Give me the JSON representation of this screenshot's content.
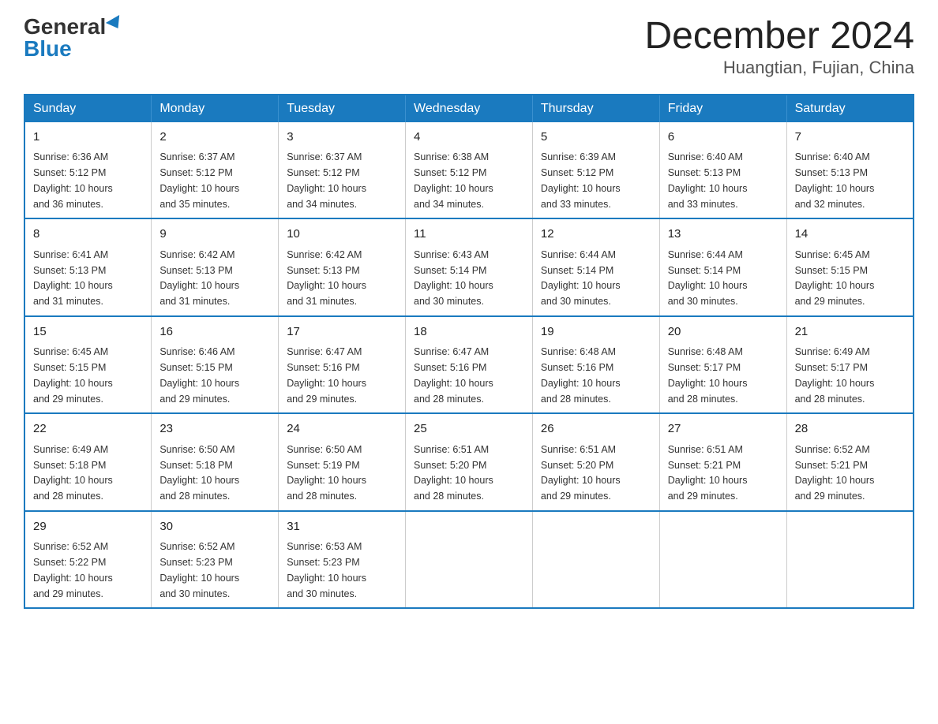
{
  "logo": {
    "general": "General",
    "blue": "Blue"
  },
  "title": "December 2024",
  "subtitle": "Huangtian, Fujian, China",
  "days_of_week": [
    "Sunday",
    "Monday",
    "Tuesday",
    "Wednesday",
    "Thursday",
    "Friday",
    "Saturday"
  ],
  "weeks": [
    [
      {
        "day": "1",
        "sunrise": "6:36 AM",
        "sunset": "5:12 PM",
        "daylight": "10 hours and 36 minutes."
      },
      {
        "day": "2",
        "sunrise": "6:37 AM",
        "sunset": "5:12 PM",
        "daylight": "10 hours and 35 minutes."
      },
      {
        "day": "3",
        "sunrise": "6:37 AM",
        "sunset": "5:12 PM",
        "daylight": "10 hours and 34 minutes."
      },
      {
        "day": "4",
        "sunrise": "6:38 AM",
        "sunset": "5:12 PM",
        "daylight": "10 hours and 34 minutes."
      },
      {
        "day": "5",
        "sunrise": "6:39 AM",
        "sunset": "5:12 PM",
        "daylight": "10 hours and 33 minutes."
      },
      {
        "day": "6",
        "sunrise": "6:40 AM",
        "sunset": "5:13 PM",
        "daylight": "10 hours and 33 minutes."
      },
      {
        "day": "7",
        "sunrise": "6:40 AM",
        "sunset": "5:13 PM",
        "daylight": "10 hours and 32 minutes."
      }
    ],
    [
      {
        "day": "8",
        "sunrise": "6:41 AM",
        "sunset": "5:13 PM",
        "daylight": "10 hours and 31 minutes."
      },
      {
        "day": "9",
        "sunrise": "6:42 AM",
        "sunset": "5:13 PM",
        "daylight": "10 hours and 31 minutes."
      },
      {
        "day": "10",
        "sunrise": "6:42 AM",
        "sunset": "5:13 PM",
        "daylight": "10 hours and 31 minutes."
      },
      {
        "day": "11",
        "sunrise": "6:43 AM",
        "sunset": "5:14 PM",
        "daylight": "10 hours and 30 minutes."
      },
      {
        "day": "12",
        "sunrise": "6:44 AM",
        "sunset": "5:14 PM",
        "daylight": "10 hours and 30 minutes."
      },
      {
        "day": "13",
        "sunrise": "6:44 AM",
        "sunset": "5:14 PM",
        "daylight": "10 hours and 30 minutes."
      },
      {
        "day": "14",
        "sunrise": "6:45 AM",
        "sunset": "5:15 PM",
        "daylight": "10 hours and 29 minutes."
      }
    ],
    [
      {
        "day": "15",
        "sunrise": "6:45 AM",
        "sunset": "5:15 PM",
        "daylight": "10 hours and 29 minutes."
      },
      {
        "day": "16",
        "sunrise": "6:46 AM",
        "sunset": "5:15 PM",
        "daylight": "10 hours and 29 minutes."
      },
      {
        "day": "17",
        "sunrise": "6:47 AM",
        "sunset": "5:16 PM",
        "daylight": "10 hours and 29 minutes."
      },
      {
        "day": "18",
        "sunrise": "6:47 AM",
        "sunset": "5:16 PM",
        "daylight": "10 hours and 28 minutes."
      },
      {
        "day": "19",
        "sunrise": "6:48 AM",
        "sunset": "5:16 PM",
        "daylight": "10 hours and 28 minutes."
      },
      {
        "day": "20",
        "sunrise": "6:48 AM",
        "sunset": "5:17 PM",
        "daylight": "10 hours and 28 minutes."
      },
      {
        "day": "21",
        "sunrise": "6:49 AM",
        "sunset": "5:17 PM",
        "daylight": "10 hours and 28 minutes."
      }
    ],
    [
      {
        "day": "22",
        "sunrise": "6:49 AM",
        "sunset": "5:18 PM",
        "daylight": "10 hours and 28 minutes."
      },
      {
        "day": "23",
        "sunrise": "6:50 AM",
        "sunset": "5:18 PM",
        "daylight": "10 hours and 28 minutes."
      },
      {
        "day": "24",
        "sunrise": "6:50 AM",
        "sunset": "5:19 PM",
        "daylight": "10 hours and 28 minutes."
      },
      {
        "day": "25",
        "sunrise": "6:51 AM",
        "sunset": "5:20 PM",
        "daylight": "10 hours and 28 minutes."
      },
      {
        "day": "26",
        "sunrise": "6:51 AM",
        "sunset": "5:20 PM",
        "daylight": "10 hours and 29 minutes."
      },
      {
        "day": "27",
        "sunrise": "6:51 AM",
        "sunset": "5:21 PM",
        "daylight": "10 hours and 29 minutes."
      },
      {
        "day": "28",
        "sunrise": "6:52 AM",
        "sunset": "5:21 PM",
        "daylight": "10 hours and 29 minutes."
      }
    ],
    [
      {
        "day": "29",
        "sunrise": "6:52 AM",
        "sunset": "5:22 PM",
        "daylight": "10 hours and 29 minutes."
      },
      {
        "day": "30",
        "sunrise": "6:52 AM",
        "sunset": "5:23 PM",
        "daylight": "10 hours and 30 minutes."
      },
      {
        "day": "31",
        "sunrise": "6:53 AM",
        "sunset": "5:23 PM",
        "daylight": "10 hours and 30 minutes."
      },
      null,
      null,
      null,
      null
    ]
  ],
  "labels": {
    "sunrise": "Sunrise:",
    "sunset": "Sunset:",
    "daylight": "Daylight:"
  }
}
